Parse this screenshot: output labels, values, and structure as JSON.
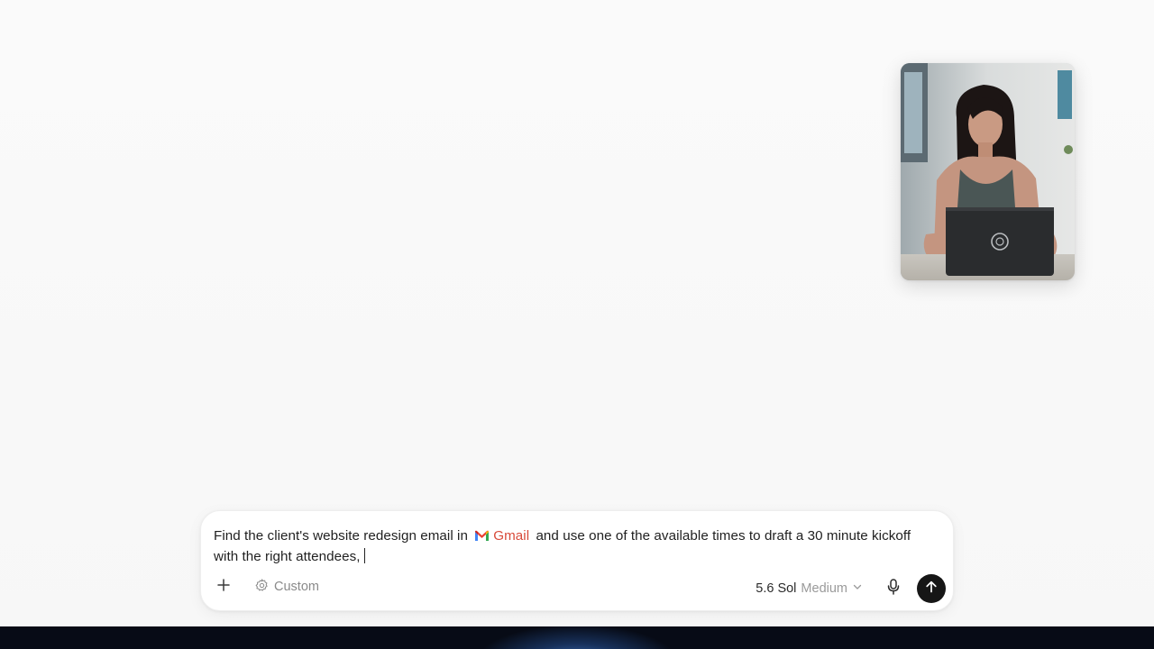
{
  "composer": {
    "prompt_before": "Find the client's website redesign email in",
    "mention_label": "Gmail",
    "prompt_after": "and use one of the available times to draft a 30 minute kickoff with the right attendees,",
    "custom_label": "Custom",
    "model_name": "5.6 Sol",
    "model_level": "Medium"
  },
  "icons": {
    "add": "plus-icon",
    "custom": "settings-gear-icon",
    "mention": "gmail-icon",
    "model_dropdown": "chevron-down-icon",
    "voice": "microphone-icon",
    "send": "arrow-up-icon"
  },
  "colors": {
    "background": "#f9f9f9",
    "send_button": "#161616",
    "mention_text": "#d84a3a"
  }
}
